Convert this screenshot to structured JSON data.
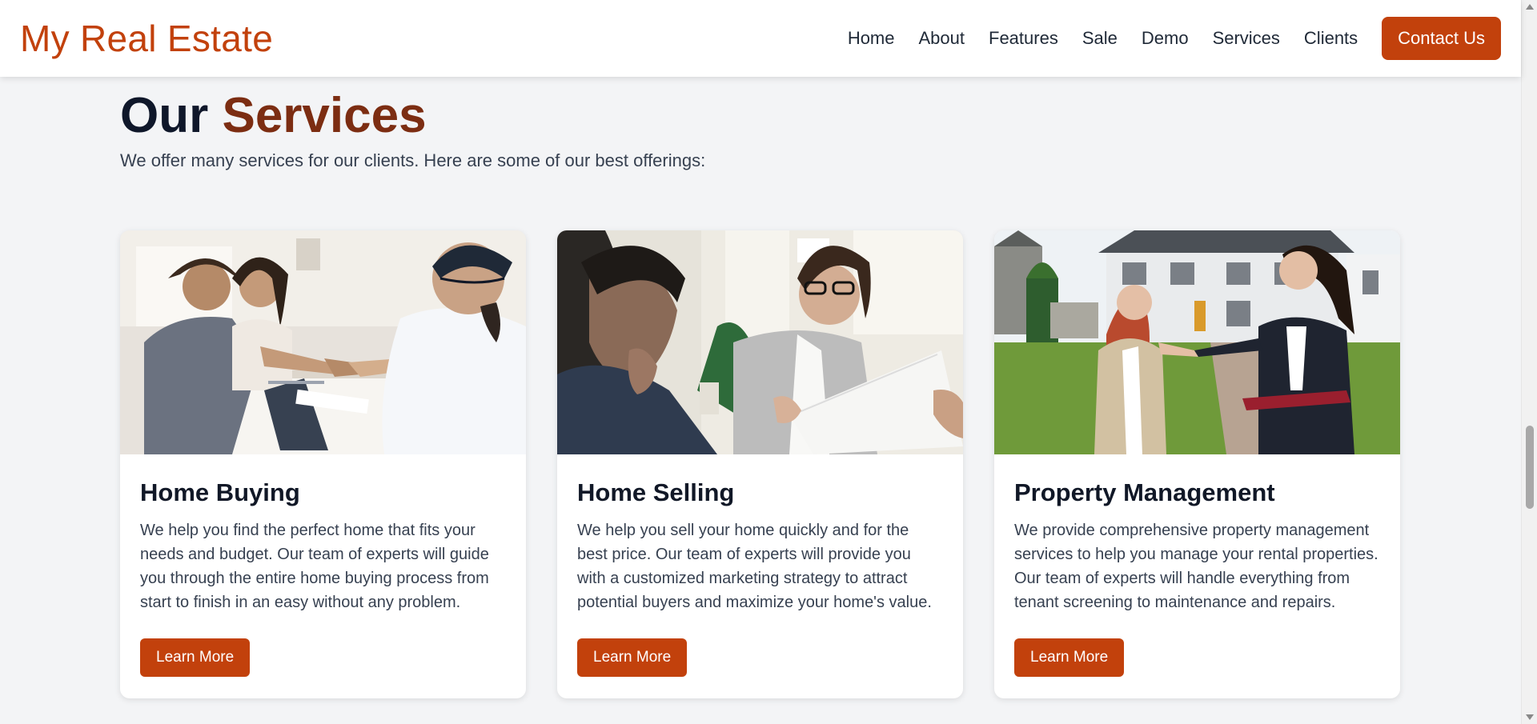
{
  "header": {
    "logo": "My Real Estate",
    "nav": [
      "Home",
      "About",
      "Features",
      "Sale",
      "Demo",
      "Services",
      "Clients"
    ],
    "contact_label": "Contact Us"
  },
  "section": {
    "title_part1": "Our",
    "title_part2": "Services",
    "subtitle": "We offer many services for our clients. Here are some of our best offerings:"
  },
  "cards": [
    {
      "title": "Home Buying",
      "text": "We help you find the perfect home that fits your needs and budget. Our team of experts will guide you through the entire home buying process from start to finish in an easy without any problem.",
      "button": "Learn More",
      "image": "handshake-meeting-photo"
    },
    {
      "title": "Home Selling",
      "text": "We help you sell your home quickly and for the best price. Our team of experts will provide you with a customized marketing strategy to attract potential buyers and maximize your home's value.",
      "button": "Learn More",
      "image": "consultation-documents-photo"
    },
    {
      "title": "Property Management",
      "text": "We provide comprehensive property management services to help you manage your rental properties. Our team of experts will handle everything from tenant screening to maintenance and repairs.",
      "button": "Learn More",
      "image": "agent-showing-house-photo"
    }
  ],
  "colors": {
    "brand": "#c2410c",
    "title_accent": "#7c2d12",
    "background": "#f3f4f6"
  }
}
